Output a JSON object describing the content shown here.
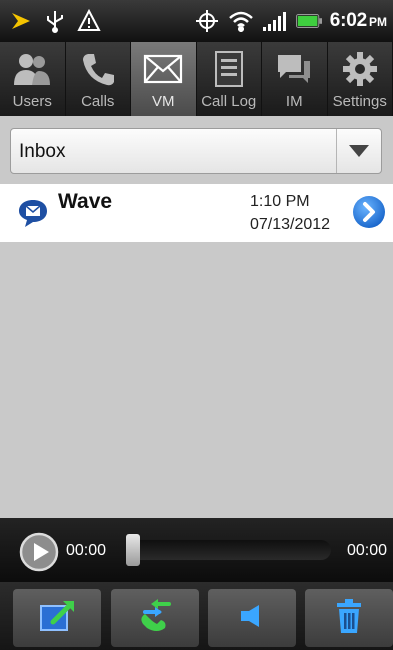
{
  "status_bar": {
    "time": "6:02",
    "ampm": "PM",
    "icons": [
      "sprint-logo-icon",
      "usb-icon",
      "warning-icon",
      "gps-icon",
      "wifi-icon",
      "signal-icon",
      "battery-icon"
    ],
    "colors": {
      "sprint": "#f5c400",
      "battery": "#3fcf3f"
    }
  },
  "tabs": [
    {
      "label": "Users",
      "icon": "users-icon",
      "active": false
    },
    {
      "label": "Calls",
      "icon": "phone-icon",
      "active": false
    },
    {
      "label": "VM",
      "icon": "envelope-icon",
      "active": true
    },
    {
      "label": "Call Log",
      "icon": "document-icon",
      "active": false
    },
    {
      "label": "IM",
      "icon": "chat-icon",
      "active": false
    },
    {
      "label": "Settings",
      "icon": "gear-icon",
      "active": false
    }
  ],
  "folder_select": {
    "selected": "Inbox"
  },
  "messages": [
    {
      "sender": "Wave",
      "time": "1:10 PM",
      "date": "07/13/2012"
    }
  ],
  "player": {
    "elapsed": "00:00",
    "total": "00:00",
    "progress": 0
  },
  "actions": [
    "compose-icon",
    "call-back-icon",
    "speaker-icon",
    "trash-icon"
  ]
}
